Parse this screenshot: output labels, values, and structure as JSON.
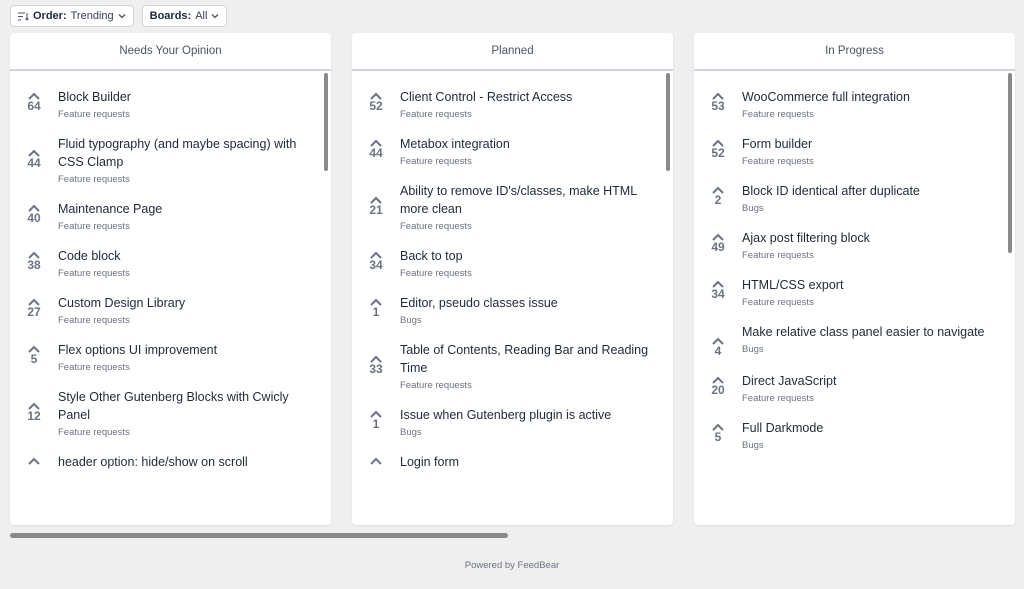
{
  "toolbar": {
    "order_label": "Order:",
    "order_value": "Trending",
    "boards_label": "Boards:",
    "boards_value": "All"
  },
  "columns": [
    {
      "title": "Needs Your Opinion",
      "items": [
        {
          "votes": "64",
          "title": "Block Builder",
          "category": "Feature requests"
        },
        {
          "votes": "44",
          "title": "Fluid typography (and maybe spacing) with CSS Clamp",
          "category": "Feature requests"
        },
        {
          "votes": "40",
          "title": "Maintenance Page",
          "category": "Feature requests"
        },
        {
          "votes": "38",
          "title": "Code block",
          "category": "Feature requests"
        },
        {
          "votes": "27",
          "title": "Custom Design Library",
          "category": "Feature requests"
        },
        {
          "votes": "5",
          "title": "Flex options UI improvement",
          "category": "Feature requests"
        },
        {
          "votes": "12",
          "title": "Style Other Gutenberg Blocks with Cwicly Panel",
          "category": "Feature requests"
        },
        {
          "votes": "",
          "title": "header option: hide/show on scroll",
          "category": ""
        }
      ]
    },
    {
      "title": "Planned",
      "items": [
        {
          "votes": "52",
          "title": "Client Control - Restrict Access",
          "category": "Feature requests"
        },
        {
          "votes": "44",
          "title": "Metabox integration",
          "category": "Feature requests"
        },
        {
          "votes": "21",
          "title": "Ability to remove ID's/classes, make HTML more clean",
          "category": "Feature requests"
        },
        {
          "votes": "34",
          "title": "Back to top",
          "category": "Feature requests"
        },
        {
          "votes": "1",
          "title": "Editor, pseudo classes issue",
          "category": "Bugs"
        },
        {
          "votes": "33",
          "title": "Table of Contents, Reading Bar and Reading Time",
          "category": "Feature requests"
        },
        {
          "votes": "1",
          "title": "Issue when Gutenberg plugin is active",
          "category": "Bugs"
        },
        {
          "votes": "",
          "title": "Login form",
          "category": ""
        }
      ]
    },
    {
      "title": "In Progress",
      "items": [
        {
          "votes": "53",
          "title": "WooCommerce full integration",
          "category": "Feature requests"
        },
        {
          "votes": "52",
          "title": "Form builder",
          "category": "Feature requests"
        },
        {
          "votes": "2",
          "title": "Block ID identical after duplicate",
          "category": "Bugs"
        },
        {
          "votes": "49",
          "title": "Ajax post filtering block",
          "category": "Feature requests"
        },
        {
          "votes": "34",
          "title": "HTML/CSS export",
          "category": "Feature requests"
        },
        {
          "votes": "4",
          "title": "Make relative class panel easier to navigate",
          "category": "Bugs"
        },
        {
          "votes": "20",
          "title": "Direct JavaScript",
          "category": "Feature requests"
        },
        {
          "votes": "5",
          "title": "Full Darkmode",
          "category": "Bugs"
        }
      ]
    }
  ],
  "footer": {
    "text": "Powered by FeedBear"
  }
}
